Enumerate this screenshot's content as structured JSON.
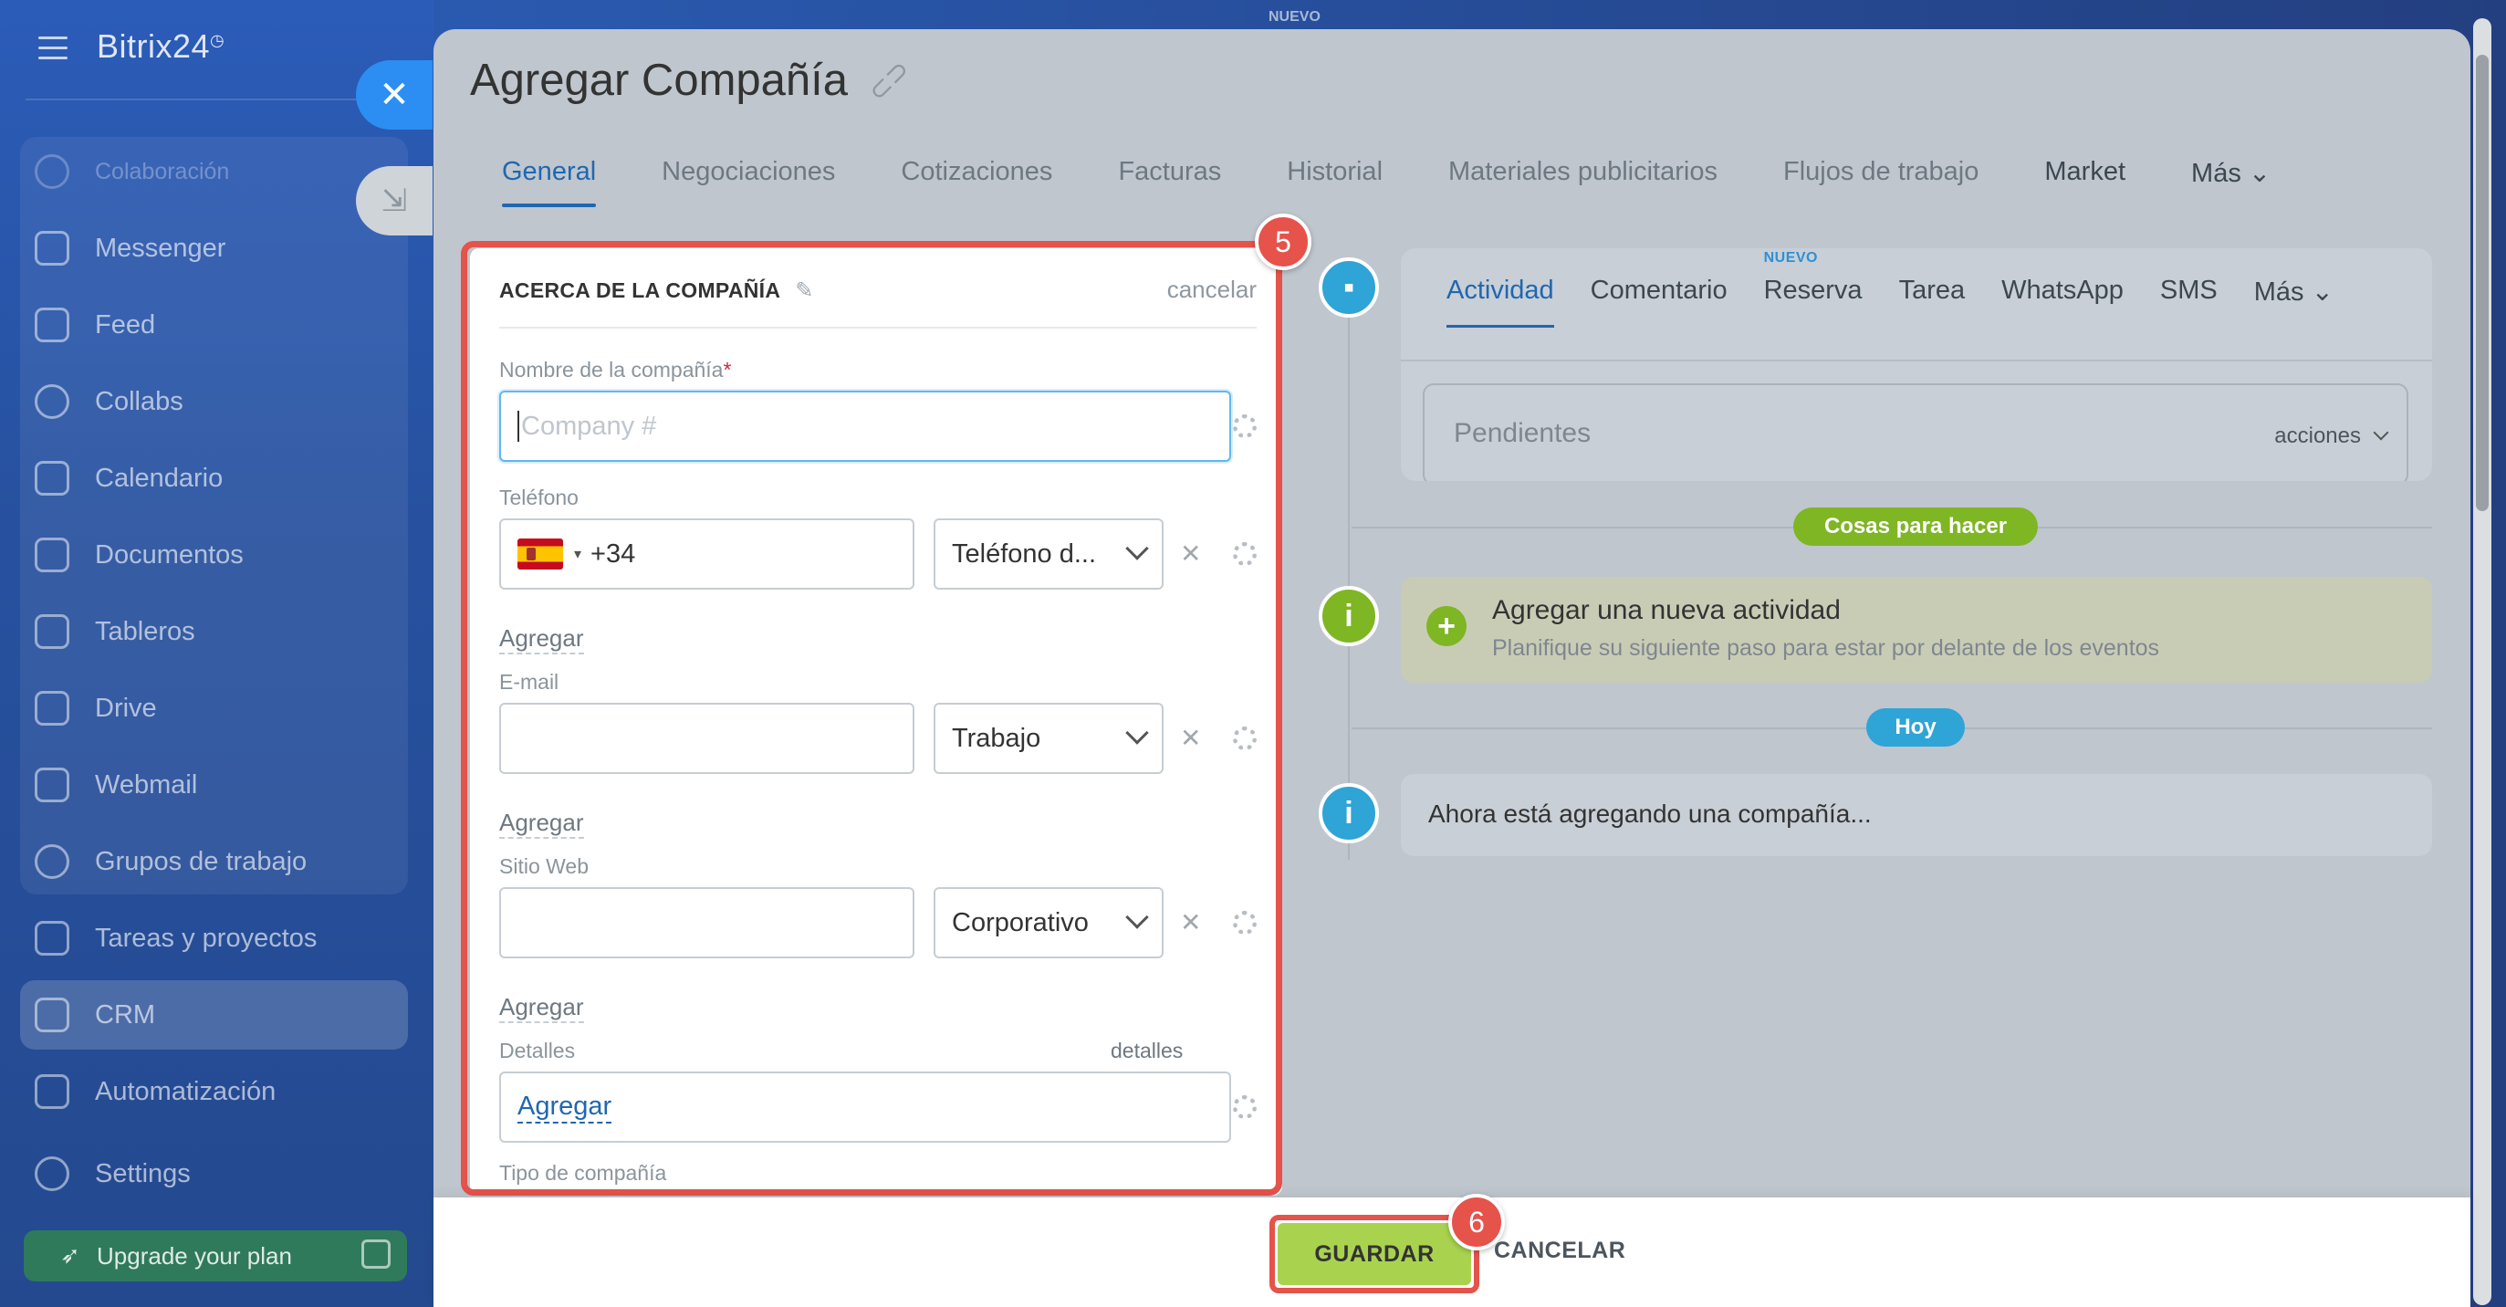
{
  "sidebar": {
    "logo": "Bitrix24",
    "items": [
      {
        "label": "Colaboración",
        "icon": "chat-bubbles-icon"
      },
      {
        "label": "Messenger",
        "icon": "chat-icon"
      },
      {
        "label": "Feed",
        "icon": "feed-icon"
      },
      {
        "label": "Collabs",
        "icon": "collabs-icon"
      },
      {
        "label": "Calendario",
        "icon": "calendar-icon"
      },
      {
        "label": "Documentos",
        "icon": "document-icon"
      },
      {
        "label": "Tableros",
        "icon": "boards-icon"
      },
      {
        "label": "Drive",
        "icon": "drive-icon"
      },
      {
        "label": "Webmail",
        "icon": "mail-icon"
      },
      {
        "label": "Grupos de trabajo",
        "icon": "groups-icon"
      },
      {
        "label": "Tareas y proyectos",
        "icon": "tasks-icon"
      },
      {
        "label": "CRM",
        "icon": "crm-filter-icon"
      },
      {
        "label": "Automatización",
        "icon": "robot-icon"
      },
      {
        "label": "Settings",
        "icon": "gear-icon"
      }
    ],
    "upgrade_label": "Upgrade your plan"
  },
  "top_ghost": "NUEVO",
  "panel": {
    "title": "Agregar Compañía",
    "tabs": [
      "General",
      "Negociaciones",
      "Cotizaciones",
      "Facturas",
      "Historial",
      "Materiales publicitarios",
      "Flujos de trabajo",
      "Market",
      "Más"
    ]
  },
  "form": {
    "section_title": "ACERCA DE LA COMPAÑÍA",
    "section_cancel": "cancelar",
    "company_name_label": "Nombre de la compañía",
    "company_name_required": "*",
    "company_name_placeholder": "Company #",
    "phone_label": "Teléfono",
    "phone_prefix": "+34",
    "phone_type": "Teléfono d...",
    "add_label": "Agregar",
    "email_label": "E-mail",
    "email_type": "Trabajo",
    "website_label": "Sitio Web",
    "website_type": "Corporativo",
    "details_label": "Detalles",
    "details_link": "detalles",
    "details_add": "Agregar",
    "company_type_label": "Tipo de compañía"
  },
  "activity": {
    "tabs": [
      "Actividad",
      "Comentario",
      "Reserva",
      "Tarea",
      "WhatsApp",
      "SMS",
      "Más"
    ],
    "new_badge": "NUEVO",
    "pending_label": "Pendientes",
    "actions_label": "acciones",
    "todo_pill": "Cosas para hacer",
    "new_activity_title": "Agregar una nueva actividad",
    "new_activity_subtitle": "Planifique su siguiente paso para estar por delante de los eventos",
    "today_pill": "Hoy",
    "info_text": "Ahora está agregando una compañía..."
  },
  "footer": {
    "save_label": "GUARDAR",
    "cancel_label": "CANCELAR"
  },
  "annotations": {
    "step5": "5",
    "step6": "6"
  },
  "colors": {
    "accent": "#2067b0",
    "save": "#a9d34f",
    "highlight": "#e5534b",
    "green": "#7eb624",
    "timeline_blue": "#2fa4d6"
  }
}
